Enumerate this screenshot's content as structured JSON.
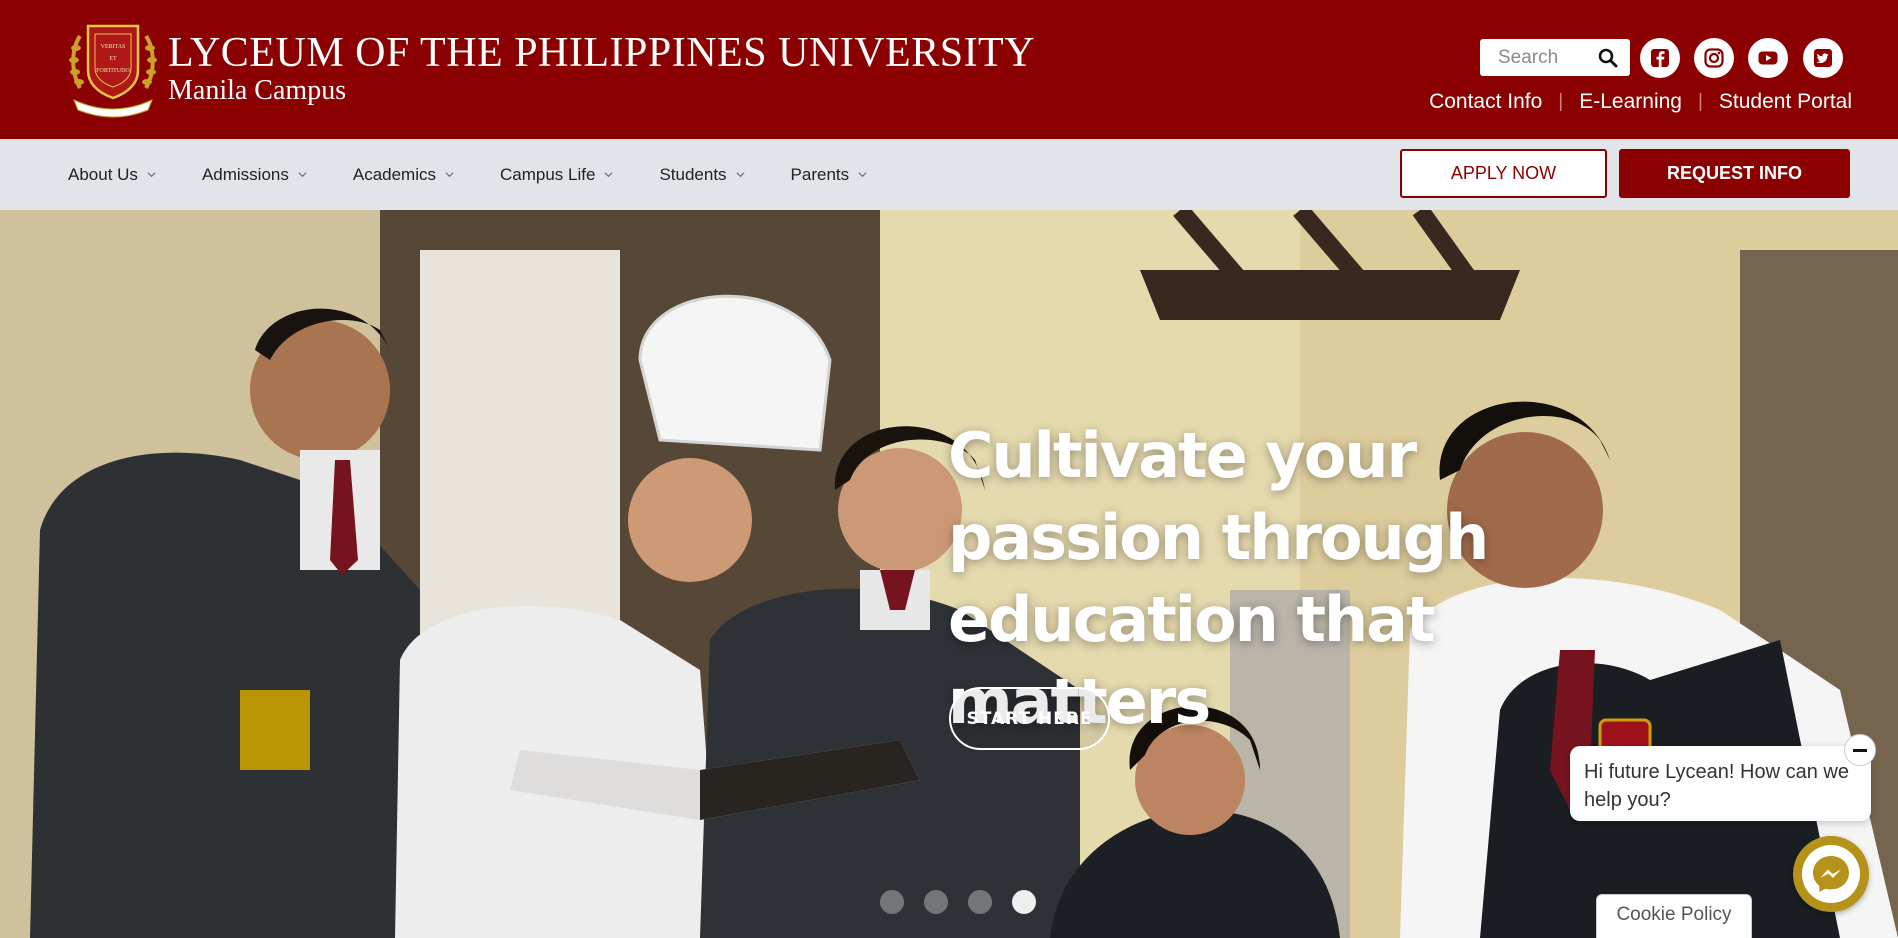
{
  "header": {
    "logo_title": "LYCEUM OF THE PHILIPPINES UNIVERSITY",
    "logo_subtitle": "Manila Campus",
    "crest_motto_top": "VERITAS",
    "crest_motto_mid": "ET",
    "crest_motto_bot": "FORTITUDO",
    "search_placeholder": "Search",
    "social": [
      "facebook-icon",
      "instagram-icon",
      "youtube-icon",
      "twitter-icon"
    ],
    "utility_links": {
      "contact": "Contact Info",
      "elearning": "E-Learning",
      "portal": "Student Portal",
      "separator": "|"
    }
  },
  "nav": {
    "items": [
      {
        "label": "About Us"
      },
      {
        "label": "Admissions"
      },
      {
        "label": "Academics"
      },
      {
        "label": "Campus Life"
      },
      {
        "label": "Students"
      },
      {
        "label": "Parents"
      }
    ],
    "apply_label": "APPLY NOW",
    "request_label": "REQUEST INFO"
  },
  "hero": {
    "title": "Cultivate your passion through education that matters",
    "cta_label": "START HERE",
    "slide_count": 4,
    "active_slide": 4
  },
  "chat": {
    "greeting": "Hi future Lycean! How can we help you?"
  },
  "cookie": {
    "label": "Cookie Policy"
  },
  "colors": {
    "brand_red": "#8b0000",
    "nav_bg": "#e1e4e8",
    "messenger_gold": "#b5931a"
  }
}
